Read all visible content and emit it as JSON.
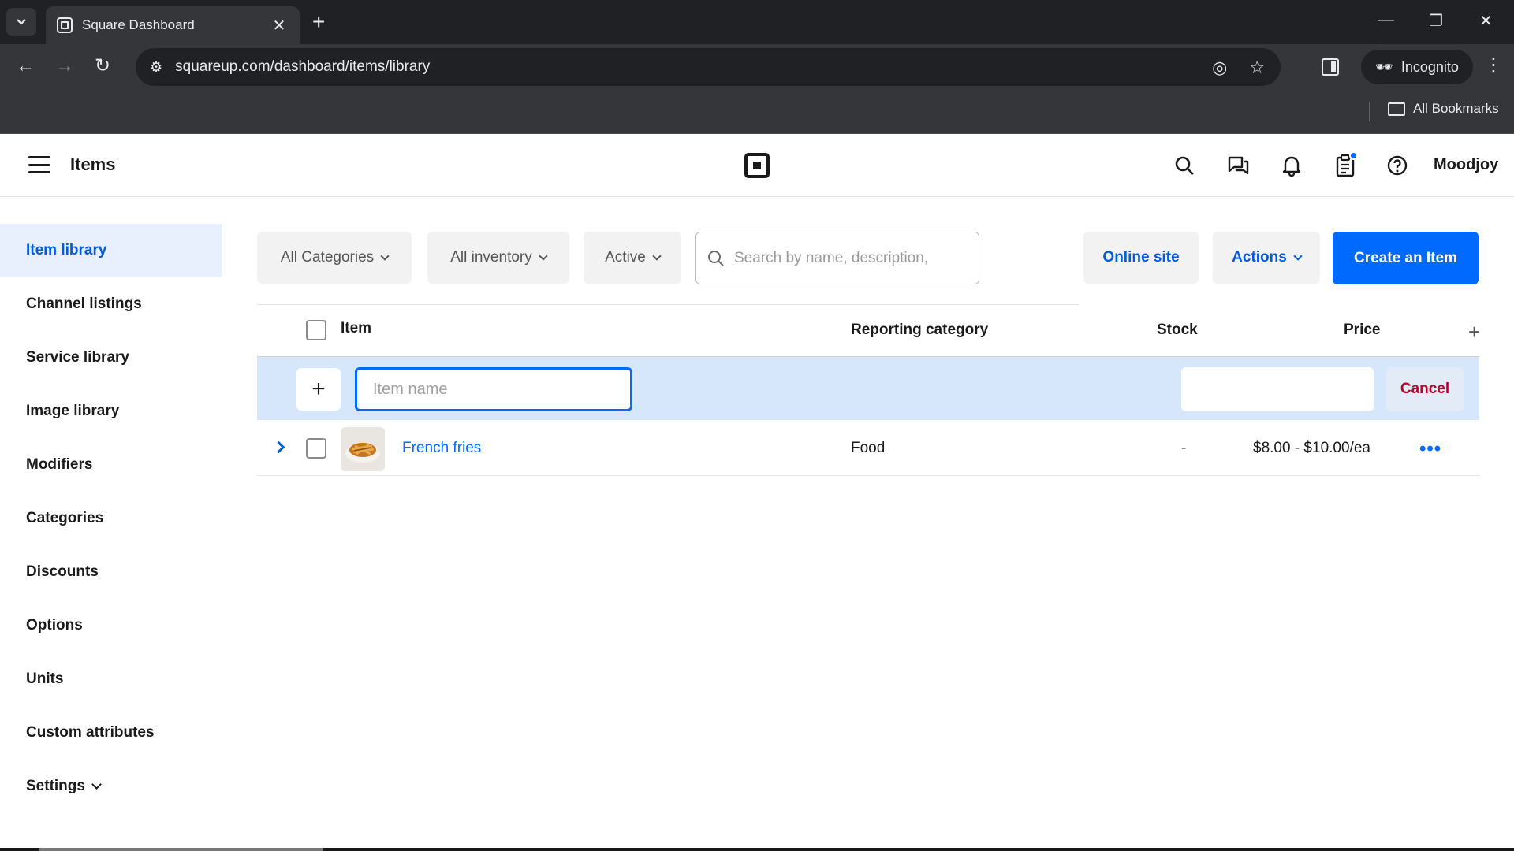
{
  "browser": {
    "tab_title": "Square Dashboard",
    "url": "squareup.com/dashboard/items/library",
    "incognito_label": "Incognito",
    "bookmarks_label": "All Bookmarks"
  },
  "header": {
    "title": "Items",
    "user_name": "Moodjoy"
  },
  "sidebar": {
    "items": [
      {
        "label": "Item library",
        "active": true
      },
      {
        "label": "Channel listings"
      },
      {
        "label": "Service library"
      },
      {
        "label": "Image library"
      },
      {
        "label": "Modifiers"
      },
      {
        "label": "Categories"
      },
      {
        "label": "Discounts"
      },
      {
        "label": "Options"
      },
      {
        "label": "Units"
      },
      {
        "label": "Custom attributes"
      },
      {
        "label": "Settings"
      }
    ]
  },
  "filters": {
    "categories": "All Categories",
    "inventory": "All inventory",
    "status": "Active",
    "search_placeholder": "Search by name, description,"
  },
  "actions": {
    "online_site": "Online site",
    "actions": "Actions",
    "create": "Create an Item"
  },
  "table": {
    "columns": {
      "item": "Item",
      "reporting_category": "Reporting category",
      "stock": "Stock",
      "price": "Price"
    },
    "new_row": {
      "name_placeholder": "Item name",
      "cancel_label": "Cancel"
    },
    "rows": [
      {
        "name": "French fries",
        "category": "Food",
        "stock": "-",
        "price": "$8.00 - $10.00/ea"
      }
    ]
  },
  "colors": {
    "brand_blue": "#006aff",
    "active_bg": "#e8f0fe",
    "cancel_red": "#b9002e"
  }
}
